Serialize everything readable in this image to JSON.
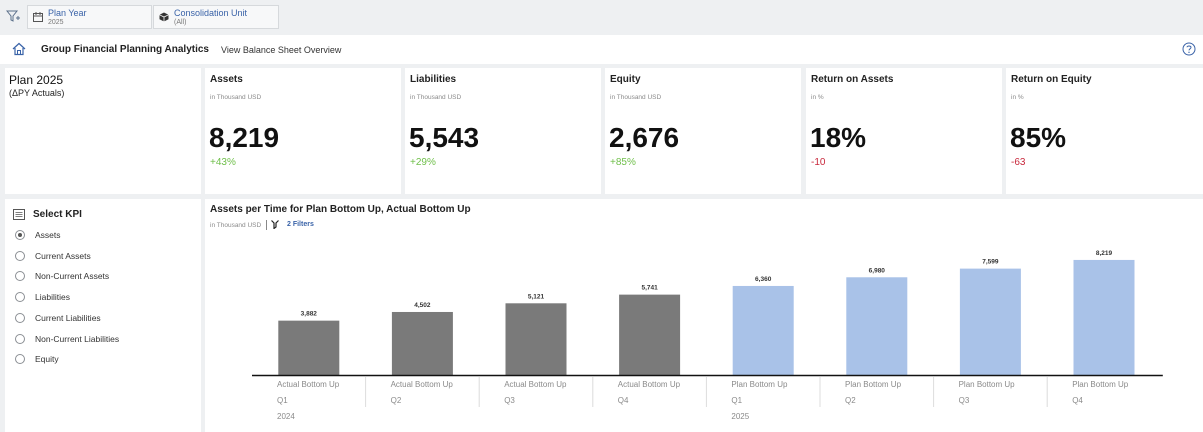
{
  "filters": [
    {
      "label": "Plan Year",
      "value": "2025",
      "icon": "calendar-icon"
    },
    {
      "label": "Consolidation Unit",
      "value": "(All)",
      "icon": "cube-icon"
    }
  ],
  "header": {
    "title": "Group Financial Planning Analytics",
    "subtitle": "View Balance Sheet Overview"
  },
  "plan": {
    "title": "Plan 2025",
    "subtitle": "(ΔPY Actuals)"
  },
  "kpis": [
    {
      "title": "Assets",
      "unit": "in Thousand USD",
      "value": "8,219",
      "delta": "+43%",
      "delta_sign": "pos"
    },
    {
      "title": "Liabilities",
      "unit": "in Thousand USD",
      "value": "5,543",
      "delta": "+29%",
      "delta_sign": "pos"
    },
    {
      "title": "Equity",
      "unit": "in Thousand USD",
      "value": "2,676",
      "delta": "+85%",
      "delta_sign": "pos"
    },
    {
      "title": "Return on Assets",
      "unit": "in %",
      "value": "18%",
      "delta": "-10",
      "delta_sign": "neg"
    },
    {
      "title": "Return on Equity",
      "unit": "in %",
      "value": "85%",
      "delta": "-63",
      "delta_sign": "neg"
    }
  ],
  "select_kpi": {
    "title": "Select KPI",
    "options": [
      "Assets",
      "Current Assets",
      "Non-Current Assets",
      "Liabilities",
      "Current Liabilities",
      "Non-Current Liabilities",
      "Equity"
    ],
    "selected": "Assets"
  },
  "chart": {
    "title": "Assets per Time for Plan Bottom Up, Actual Bottom Up",
    "unit": "in Thousand USD",
    "filters_label": "2 Filters"
  },
  "colors": {
    "actual": "#7a7a7a",
    "plan": "#a9c2e8",
    "positive": "#6fbf4a",
    "negative": "#c8283c",
    "link": "#3a63a8"
  },
  "chart_data": {
    "type": "bar",
    "categories": [
      {
        "version": "Actual Bottom Up",
        "quarter": "Q1",
        "year": "2024"
      },
      {
        "version": "Actual Bottom Up",
        "quarter": "Q2",
        "year": ""
      },
      {
        "version": "Actual Bottom Up",
        "quarter": "Q3",
        "year": ""
      },
      {
        "version": "Actual Bottom Up",
        "quarter": "Q4",
        "year": ""
      },
      {
        "version": "Plan Bottom Up",
        "quarter": "Q1",
        "year": "2025"
      },
      {
        "version": "Plan Bottom Up",
        "quarter": "Q2",
        "year": ""
      },
      {
        "version": "Plan Bottom Up",
        "quarter": "Q3",
        "year": ""
      },
      {
        "version": "Plan Bottom Up",
        "quarter": "Q4",
        "year": ""
      }
    ],
    "values": [
      3882,
      4502,
      5121,
      5741,
      6360,
      6980,
      7599,
      8219
    ],
    "value_labels": [
      "3,882",
      "4,502",
      "5,121",
      "5,741",
      "6,360",
      "6,980",
      "7,599",
      "8,219"
    ],
    "series_of_bar": [
      "actual",
      "actual",
      "actual",
      "actual",
      "plan",
      "plan",
      "plan",
      "plan"
    ],
    "ylim": [
      0,
      9000
    ],
    "grid": false,
    "legend": "none"
  }
}
